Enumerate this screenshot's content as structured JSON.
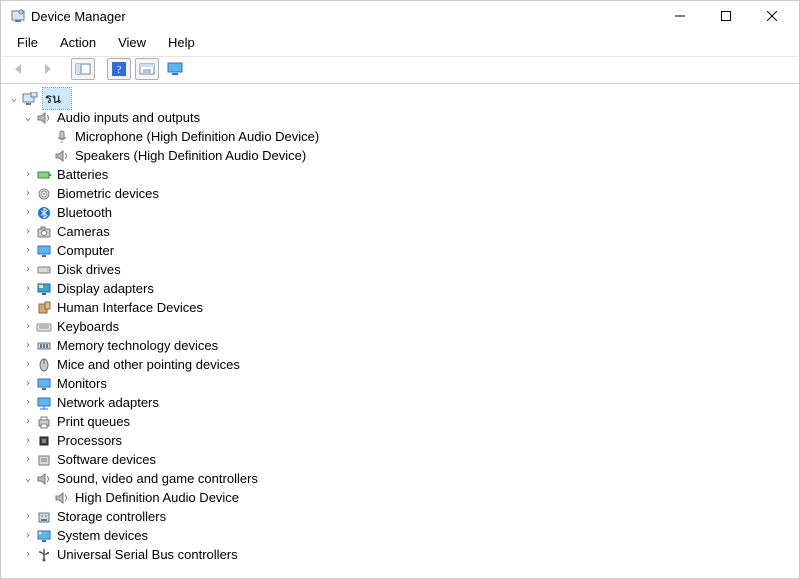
{
  "window": {
    "title": "Device Manager"
  },
  "menu": {
    "items": [
      "File",
      "Action",
      "View",
      "Help"
    ]
  },
  "toolbar": {
    "buttons": [
      {
        "name": "back-button",
        "icon": "arrow-left",
        "enabled": false
      },
      {
        "name": "forward-button",
        "icon": "arrow-right",
        "enabled": false
      },
      {
        "name": "sep"
      },
      {
        "name": "show-hide-console-button",
        "icon": "console-tree",
        "enabled": true
      },
      {
        "name": "sep"
      },
      {
        "name": "help-button",
        "icon": "help",
        "enabled": true
      },
      {
        "name": "properties-button",
        "icon": "properties",
        "enabled": true
      },
      {
        "name": "scan-hardware-button",
        "icon": "monitor",
        "enabled": true
      }
    ]
  },
  "tree": {
    "root": {
      "label": "รน",
      "icon": "computer",
      "expanded": true,
      "selected": true
    },
    "categories": [
      {
        "label": "Audio inputs and outputs",
        "icon": "speaker",
        "expanded": true,
        "children": [
          {
            "label": "Microphone (High Definition Audio Device)",
            "icon": "mic"
          },
          {
            "label": "Speakers (High Definition Audio Device)",
            "icon": "speaker"
          }
        ]
      },
      {
        "label": "Batteries",
        "icon": "battery"
      },
      {
        "label": "Biometric devices",
        "icon": "biometric"
      },
      {
        "label": "Bluetooth",
        "icon": "bluetooth"
      },
      {
        "label": "Cameras",
        "icon": "camera"
      },
      {
        "label": "Computer",
        "icon": "monitor"
      },
      {
        "label": "Disk drives",
        "icon": "disk"
      },
      {
        "label": "Display adapters",
        "icon": "display"
      },
      {
        "label": "Human Interface Devices",
        "icon": "hid"
      },
      {
        "label": "Keyboards",
        "icon": "keyboard"
      },
      {
        "label": "Memory technology devices",
        "icon": "memory"
      },
      {
        "label": "Mice and other pointing devices",
        "icon": "mouse"
      },
      {
        "label": "Monitors",
        "icon": "monitor"
      },
      {
        "label": "Network adapters",
        "icon": "network"
      },
      {
        "label": "Print queues",
        "icon": "printer"
      },
      {
        "label": "Processors",
        "icon": "cpu"
      },
      {
        "label": "Software devices",
        "icon": "software"
      },
      {
        "label": "Sound, video and game controllers",
        "icon": "speaker",
        "expanded": true,
        "children": [
          {
            "label": "High Definition Audio Device",
            "icon": "speaker"
          }
        ]
      },
      {
        "label": "Storage controllers",
        "icon": "storage"
      },
      {
        "label": "System devices",
        "icon": "system"
      },
      {
        "label": "Universal Serial Bus controllers",
        "icon": "usb"
      }
    ]
  }
}
